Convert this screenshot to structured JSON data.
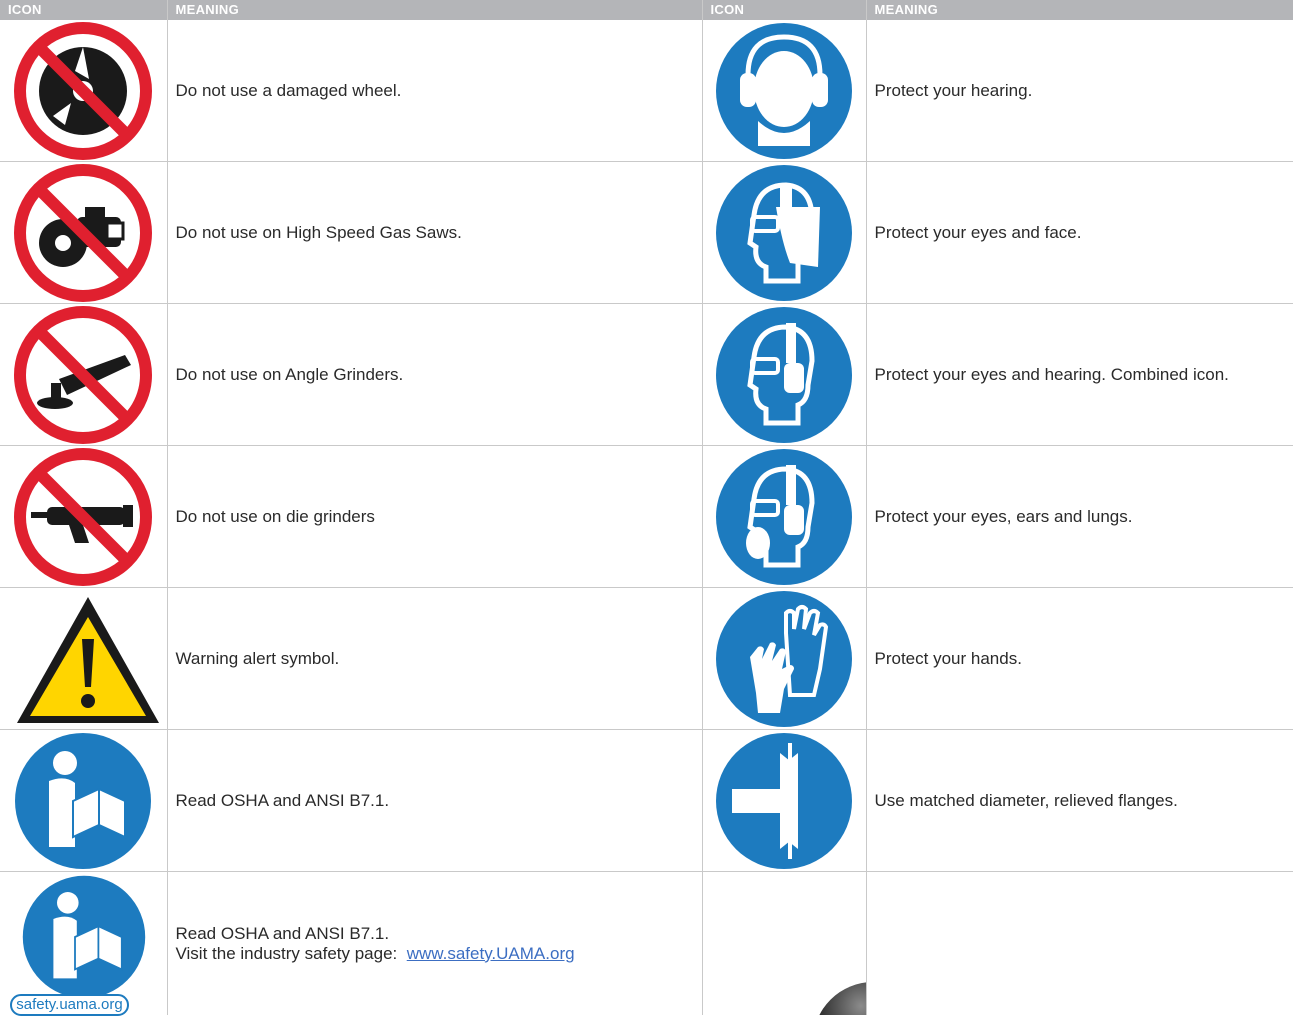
{
  "headers": {
    "icon": "ICON",
    "meaning": "MEANING",
    "icon2": "ICON",
    "meaning2": "MEANING"
  },
  "rows": [
    {
      "left": {
        "icon": "no-damaged-wheel-icon",
        "text": "Do not use a damaged wheel."
      },
      "right": {
        "icon": "hearing-protection-icon",
        "text": "Protect your hearing."
      }
    },
    {
      "left": {
        "icon": "no-gas-saw-icon",
        "text": "Do not use on High Speed Gas Saws."
      },
      "right": {
        "icon": "eye-face-protection-icon",
        "text": "Protect your eyes and face."
      }
    },
    {
      "left": {
        "icon": "no-angle-grinder-icon",
        "text": "Do not use on Angle Grinders."
      },
      "right": {
        "icon": "eye-hearing-protection-icon",
        "text": "Protect your eyes and hearing. Combined icon."
      }
    },
    {
      "left": {
        "icon": "no-die-grinder-icon",
        "text": "Do not use on die grinders"
      },
      "right": {
        "icon": "eye-ear-lung-protection-icon",
        "text": "Protect your eyes, ears and lungs."
      }
    },
    {
      "left": {
        "icon": "warning-triangle-icon",
        "text": "Warning alert symbol."
      },
      "right": {
        "icon": "hand-protection-icon",
        "text": "Protect your hands."
      }
    },
    {
      "left": {
        "icon": "read-manual-icon",
        "text": "Read OSHA and ANSI B7.1."
      },
      "right": {
        "icon": "matched-flanges-icon",
        "text": "Use matched diameter, relieved flanges."
      }
    },
    {
      "left": {
        "icon": "read-manual-icon",
        "badge": "safety.uama.org",
        "text_line1": "Read OSHA and ANSI B7.1.",
        "text_line2_prefix": "Visit the industry safety page:",
        "link": "www.safety.UAMA.org"
      },
      "right": {
        "icon": "",
        "text": ""
      }
    }
  ],
  "colors": {
    "prohibition_red": "#e0202f",
    "mandatory_blue": "#1d7bbf",
    "warning_yellow": "#ffd500",
    "header_gray": "#b4b5b8"
  }
}
